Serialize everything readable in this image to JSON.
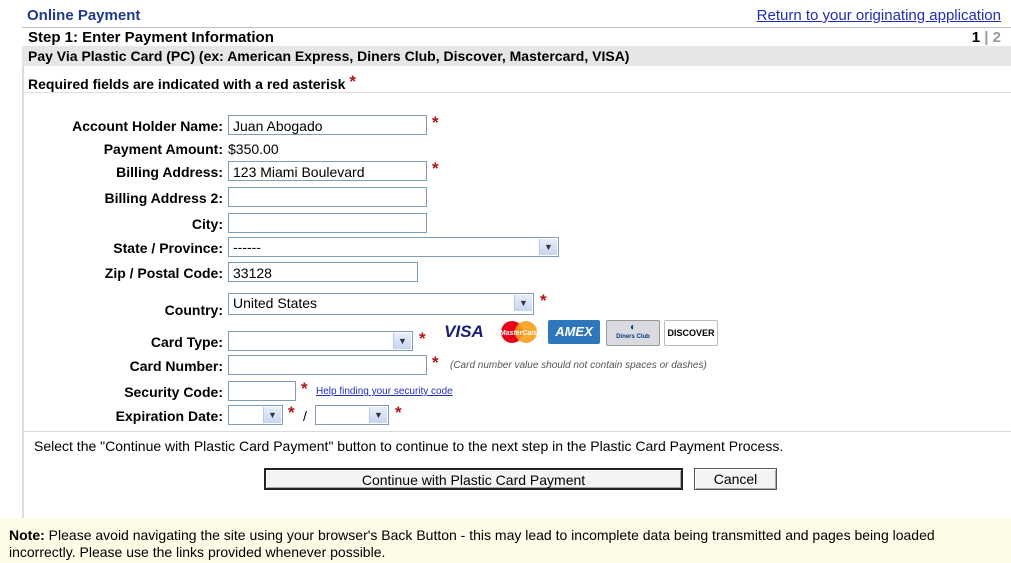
{
  "header": {
    "app_title": "Online Payment",
    "return_link": "Return to your originating application"
  },
  "step": {
    "title": "Step 1: Enter Payment Information",
    "current": "1",
    "separator": "|",
    "next": "2"
  },
  "pay_via": "Pay Via Plastic Card (PC) (ex: American Express, Diners Club, Discover, Mastercard, VISA)",
  "required_note": "Required fields are indicated with a red asterisk",
  "asterisk": "*",
  "form": {
    "account_holder": {
      "label": "Account Holder Name:",
      "value": "Juan Abogado"
    },
    "payment_amount": {
      "label": "Payment Amount:",
      "value": "$350.00"
    },
    "billing_address": {
      "label": "Billing Address:",
      "value": "123 Miami Boulevard"
    },
    "billing_address2": {
      "label": "Billing Address 2:",
      "value": ""
    },
    "city": {
      "label": "City:",
      "value": ""
    },
    "state": {
      "label": "State / Province:",
      "value": "------"
    },
    "zip": {
      "label": "Zip / Postal Code:",
      "value": "33128"
    },
    "country": {
      "label": "Country:",
      "value": "United States"
    },
    "card_type": {
      "label": "Card Type:",
      "value": ""
    },
    "card_number": {
      "label": "Card Number:",
      "value": "",
      "hint": "(Card number value should not contain spaces or dashes)"
    },
    "security_code": {
      "label": "Security Code:",
      "value": "",
      "help": "Help finding your security code"
    },
    "expiration": {
      "label": "Expiration Date:",
      "month": "",
      "year": "",
      "slash": "/"
    }
  },
  "card_logos": [
    {
      "name": "visa-logo",
      "text": "VISA",
      "color": "#1a1f71"
    },
    {
      "name": "mastercard-logo",
      "text": "MasterCard",
      "color": "#eb001b"
    },
    {
      "name": "amex-logo",
      "text": "AMEX",
      "color": "#2e77bc"
    },
    {
      "name": "diners-club-logo",
      "text": "Diners Club",
      "color": "#0079be"
    },
    {
      "name": "discover-logo",
      "text": "DISCOVER",
      "color": "#f58220"
    }
  ],
  "instructions": "Select the \"Continue with Plastic Card Payment\" button to continue to the next step in the Plastic Card Payment Process.",
  "buttons": {
    "continue": "Continue with Plastic Card Payment",
    "cancel": "Cancel"
  },
  "note": {
    "label": "Note:",
    "text": " Please avoid navigating the site using your browser's Back Button - this may lead to incomplete data being transmitted and pages being loaded incorrectly. Please use the links provided whenever possible."
  }
}
